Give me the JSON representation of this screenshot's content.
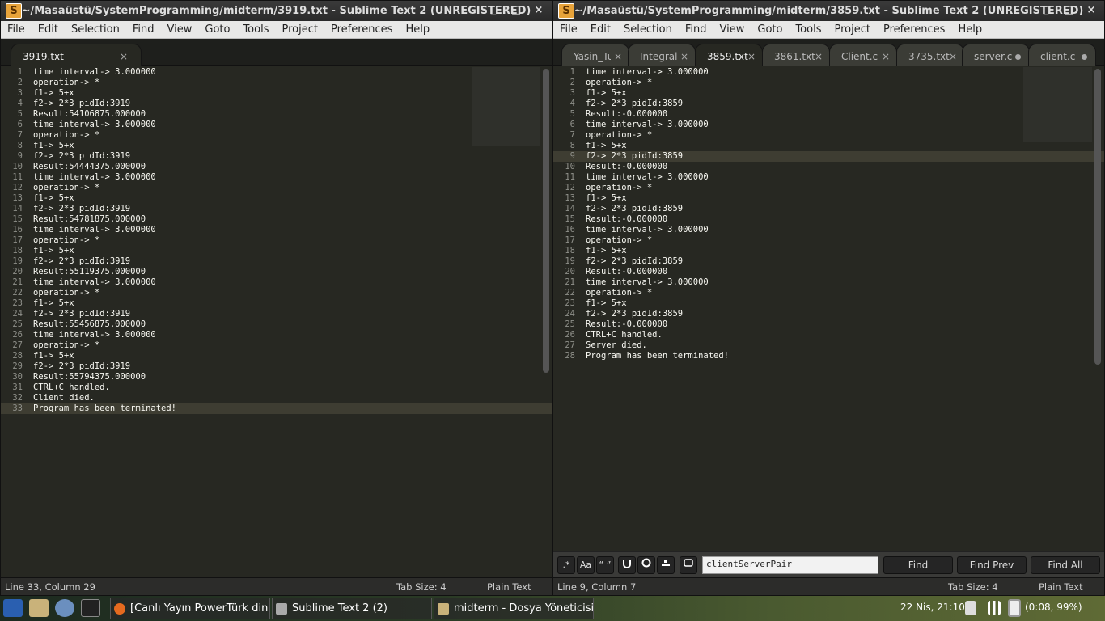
{
  "left": {
    "title": "~/Masaüstü/SystemProgramming/midterm/3919.txt - Sublime Text 2 (UNREGISTERED)",
    "menu": [
      "File",
      "Edit",
      "Selection",
      "Find",
      "View",
      "Goto",
      "Tools",
      "Project",
      "Preferences",
      "Help"
    ],
    "tab": "3919.txt",
    "tab_close": "×",
    "lines": [
      "time interval-> 3.000000",
      "operation-> *",
      "f1-> 5+x",
      "f2-> 2*3 pidId:3919",
      "Result:54106875.000000",
      "time interval-> 3.000000",
      "operation-> *",
      "f1-> 5+x",
      "f2-> 2*3 pidId:3919",
      "Result:54444375.000000",
      "time interval-> 3.000000",
      "operation-> *",
      "f1-> 5+x",
      "f2-> 2*3 pidId:3919",
      "Result:54781875.000000",
      "time interval-> 3.000000",
      "operation-> *",
      "f1-> 5+x",
      "f2-> 2*3 pidId:3919",
      "Result:55119375.000000",
      "time interval-> 3.000000",
      "operation-> *",
      "f1-> 5+x",
      "f2-> 2*3 pidId:3919",
      "Result:55456875.000000",
      "time interval-> 3.000000",
      "operation-> *",
      "f1-> 5+x",
      "f2-> 2*3 pidId:3919",
      "Result:55794375.000000",
      "CTRL+C handled.",
      "Client died.",
      "Program has been terminated!"
    ],
    "highlight_line": 33,
    "status": {
      "position": "Line 33, Column 29",
      "tabsize": "Tab Size: 4",
      "syntax": "Plain Text"
    }
  },
  "right": {
    "title": "~/Masaüstü/SystemProgramming/midterm/3859.txt - Sublime Text 2 (UNREGISTERED)",
    "menu": [
      "File",
      "Edit",
      "Selection",
      "Find",
      "View",
      "Goto",
      "Tools",
      "Project",
      "Preferences",
      "Help"
    ],
    "tabs": [
      {
        "label": "Yasin_Tu",
        "mark": "close"
      },
      {
        "label": "Integral",
        "mark": "close"
      },
      {
        "label": "3859.txt",
        "mark": "close",
        "active": true
      },
      {
        "label": "3861.txt",
        "mark": "close"
      },
      {
        "label": "Client.c",
        "mark": "close"
      },
      {
        "label": "3735.txt",
        "mark": "close"
      },
      {
        "label": "server.c",
        "mark": "dot"
      },
      {
        "label": "client.c",
        "mark": "dot"
      }
    ],
    "tab_close": "×",
    "lines": [
      "time interval-> 3.000000",
      "operation-> *",
      "f1-> 5+x",
      "f2-> 2*3 pidId:3859",
      "Result:-0.000000",
      "time interval-> 3.000000",
      "operation-> *",
      "f1-> 5+x",
      "f2-> 2*3 pidId:3859",
      "Result:-0.000000",
      "time interval-> 3.000000",
      "operation-> *",
      "f1-> 5+x",
      "f2-> 2*3 pidId:3859",
      "Result:-0.000000",
      "time interval-> 3.000000",
      "operation-> *",
      "f1-> 5+x",
      "f2-> 2*3 pidId:3859",
      "Result:-0.000000",
      "time interval-> 3.000000",
      "operation-> *",
      "f1-> 5+x",
      "f2-> 2*3 pidId:3859",
      "Result:-0.000000",
      "CTRL+C handled.",
      "Server died.",
      "Program has been terminated!"
    ],
    "highlight_line": 9,
    "find": {
      "regex": ".*",
      "case": "Aa",
      "word": "“ ”",
      "query": "clientServerPair",
      "find": "Find",
      "find_prev": "Find Prev",
      "find_all": "Find All"
    },
    "status": {
      "position": "Line 9, Column 7",
      "tabsize": "Tab Size: 4",
      "syntax": "Plain Text"
    }
  },
  "taskbar": {
    "tasks": [
      "[Canlı Yayın PowerTürk dinl...",
      "Sublime Text 2 (2)",
      "midterm - Dosya Yöneticisi"
    ],
    "clock": "22 Nis, 21:10",
    "battery": "(0:08, 99%)"
  },
  "window_buttons": [
    "_",
    "□",
    "×"
  ],
  "app_icon_letter": "S"
}
